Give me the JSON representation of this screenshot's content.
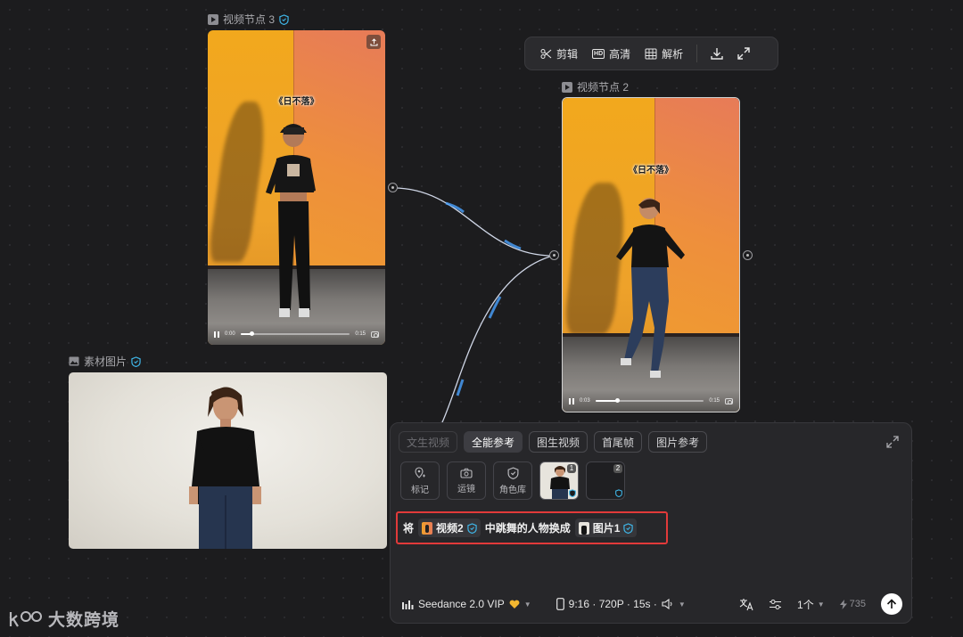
{
  "nodes": {
    "video3": {
      "label": "视频节点 3",
      "caption": "《日不落》",
      "time_current": "0:00",
      "time_total": "0:15",
      "progress": 0.1
    },
    "video2": {
      "label": "视频节点 2",
      "caption": "《日不落》",
      "time_current": "0:03",
      "time_total": "0:15",
      "progress": 0.2
    },
    "image": {
      "label": "素材图片"
    }
  },
  "toolbar": {
    "edit_label": "剪辑",
    "hd_label": "高清",
    "analyze_label": "解析",
    "hd_badge": "HD"
  },
  "panel": {
    "tabs": [
      {
        "label": "文生视频",
        "state": "disabled"
      },
      {
        "label": "全能参考",
        "state": "active"
      },
      {
        "label": "图生视频",
        "state": "normal"
      },
      {
        "label": "首尾帧",
        "state": "normal"
      },
      {
        "label": "图片参考",
        "state": "normal"
      }
    ],
    "tools": [
      {
        "label": "标记",
        "icon": "marker-pin-icon"
      },
      {
        "label": "运镜",
        "icon": "camera-icon"
      },
      {
        "label": "角色库",
        "icon": "shield-icon"
      }
    ],
    "slots": [
      {
        "num": "1"
      },
      {
        "num": "2"
      }
    ],
    "prompt": {
      "prefix": "将",
      "chip1": "视频2",
      "middle": "中跳舞的人物换成",
      "chip2": "图片1"
    },
    "model": "Seedance 2.0 VIP",
    "settings": "9:16 · 720P · 15s ·",
    "count": "1个",
    "credits": "735"
  },
  "watermark": "大数跨境",
  "colors": {
    "highlight_border": "#e23a3a",
    "accent_blue": "#4aa3ff",
    "link_curve": "#cfd6e6"
  }
}
